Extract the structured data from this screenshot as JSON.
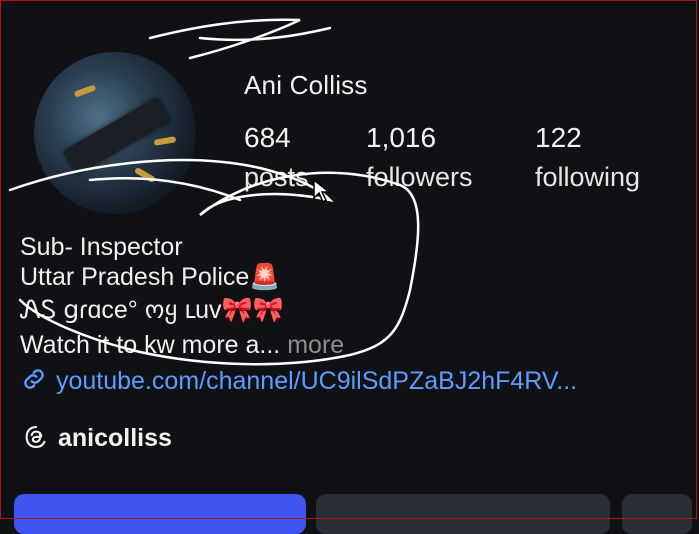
{
  "profile": {
    "name": "Ani Colliss",
    "stats": [
      {
        "value": "684",
        "label": "posts"
      },
      {
        "value": "1,016",
        "label": "followers"
      },
      {
        "value": "122",
        "label": "following"
      }
    ],
    "bio": {
      "line1": "Sub- Inspector",
      "line2": "Uttar Pradesh Police",
      "line2_emoji": "🚨",
      "line3": "ᏁᏚ ցɾɑce° ოყ ւuv",
      "line3_emoji": "🎀🎀",
      "line4": "Watch it to kw more a...",
      "more": " more"
    },
    "link": "youtube.com/channel/UC9ilSdPZaBJ2hF4RV...",
    "threads_handle": "anicolliss"
  },
  "icons": {
    "link": "link-icon",
    "threads": "threads-icon",
    "cursor": "mouse-cursor-icon"
  },
  "colors": {
    "background": "#0f1115",
    "link": "#5f9cff",
    "follow_button": "#3f55f0",
    "secondary_button": "#2a2f37"
  }
}
